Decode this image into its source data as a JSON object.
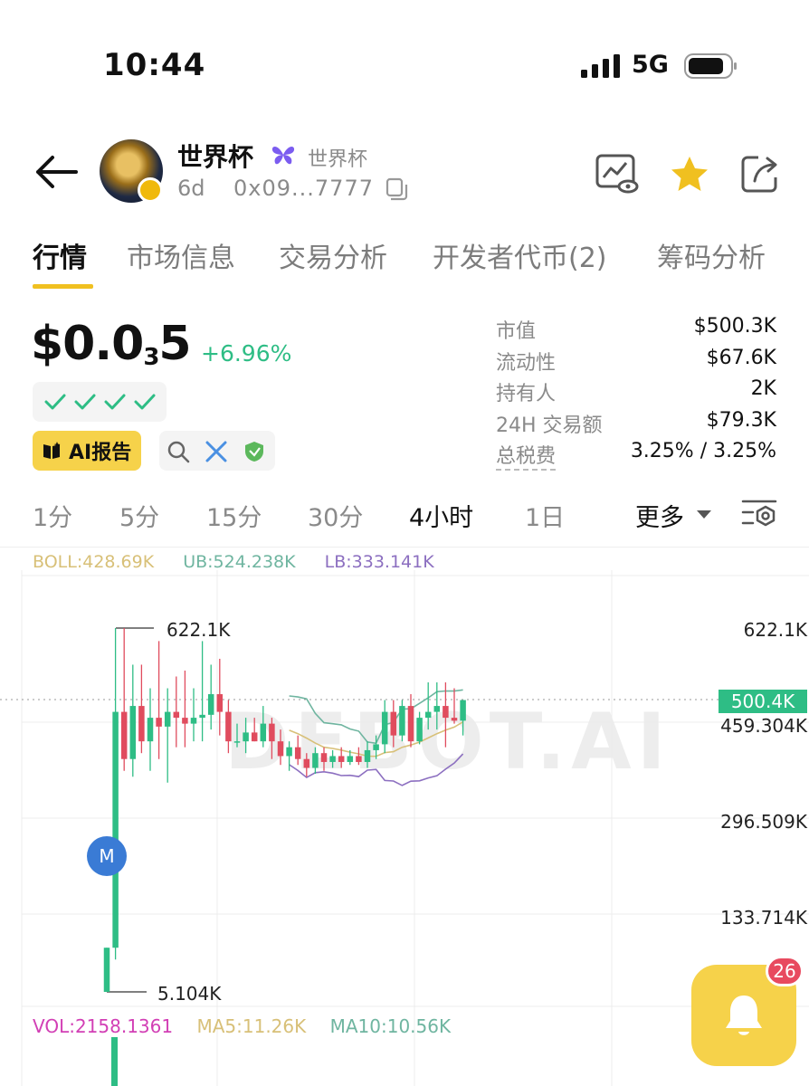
{
  "status_bar": {
    "time": "10:44",
    "network": "5G"
  },
  "header": {
    "token_name": "世界杯",
    "token_subname": "世界杯",
    "age": "6d",
    "address": "0x09...7777"
  },
  "tabs": [
    {
      "label": "行情",
      "active": true
    },
    {
      "label": "市场信息"
    },
    {
      "label": "交易分析"
    },
    {
      "label": "开发者代币(2)"
    },
    {
      "label": "筹码分析"
    }
  ],
  "price": {
    "prefix": "$0.0",
    "zero_count": "3",
    "suffix": "5",
    "change": "+6.96%"
  },
  "badges": {
    "ai_report": "AI报告"
  },
  "stats": [
    {
      "label": "市值",
      "value": "$500.3K"
    },
    {
      "label": "流动性",
      "value": "$67.6K"
    },
    {
      "label": "持有人",
      "value": "2K"
    },
    {
      "label": "24H 交易额",
      "value": "$79.3K"
    },
    {
      "label": "总税费",
      "value": "3.25% / 3.25%"
    }
  ],
  "timeframes": [
    "1分",
    "5分",
    "15分",
    "30分",
    "4小时",
    "1日"
  ],
  "active_timeframe": "4小时",
  "more_label": "更多",
  "colors": {
    "up": "#2ebd85",
    "down": "#e04c5e",
    "accent": "#f0c020"
  },
  "chart_data": {
    "type": "candlestick",
    "indicators": {
      "boll": "BOLL:428.69K",
      "ub": "UB:524.238K",
      "lb": "LB:333.141K"
    },
    "y_axis_ticks": [
      "622.1K",
      "459.304K",
      "296.509K",
      "133.714K"
    ],
    "last_price": "500.4K",
    "high_label": "622.1K",
    "low_label": "5.104K",
    "marker": "M",
    "watermark": "DEBOT.AI",
    "ylim": [
      5.104,
      622.1
    ],
    "candles": [
      {
        "o": 5.1,
        "h": 80,
        "l": 5.1,
        "c": 80
      },
      {
        "o": 80,
        "h": 622.1,
        "l": 60,
        "c": 480
      },
      {
        "o": 480,
        "h": 622.1,
        "l": 380,
        "c": 400
      },
      {
        "o": 400,
        "h": 560,
        "l": 370,
        "c": 490
      },
      {
        "o": 490,
        "h": 560,
        "l": 410,
        "c": 430
      },
      {
        "o": 430,
        "h": 520,
        "l": 380,
        "c": 470
      },
      {
        "o": 470,
        "h": 600,
        "l": 400,
        "c": 455
      },
      {
        "o": 455,
        "h": 520,
        "l": 360,
        "c": 480
      },
      {
        "o": 480,
        "h": 540,
        "l": 420,
        "c": 470
      },
      {
        "o": 470,
        "h": 550,
        "l": 420,
        "c": 460
      },
      {
        "o": 460,
        "h": 520,
        "l": 430,
        "c": 470
      },
      {
        "o": 470,
        "h": 600,
        "l": 430,
        "c": 475
      },
      {
        "o": 475,
        "h": 560,
        "l": 450,
        "c": 510
      },
      {
        "o": 510,
        "h": 570,
        "l": 440,
        "c": 480
      },
      {
        "o": 480,
        "h": 500,
        "l": 410,
        "c": 430
      },
      {
        "o": 430,
        "h": 460,
        "l": 420,
        "c": 430
      },
      {
        "o": 430,
        "h": 470,
        "l": 410,
        "c": 445
      },
      {
        "o": 445,
        "h": 470,
        "l": 430,
        "c": 430
      },
      {
        "o": 430,
        "h": 490,
        "l": 420,
        "c": 460
      },
      {
        "o": 460,
        "h": 470,
        "l": 400,
        "c": 430
      },
      {
        "o": 430,
        "h": 450,
        "l": 390,
        "c": 405
      },
      {
        "o": 405,
        "h": 430,
        "l": 380,
        "c": 420
      },
      {
        "o": 420,
        "h": 440,
        "l": 390,
        "c": 400
      },
      {
        "o": 400,
        "h": 410,
        "l": 370,
        "c": 385
      },
      {
        "o": 385,
        "h": 420,
        "l": 375,
        "c": 410
      },
      {
        "o": 410,
        "h": 420,
        "l": 380,
        "c": 395
      },
      {
        "o": 395,
        "h": 415,
        "l": 385,
        "c": 405
      },
      {
        "o": 405,
        "h": 420,
        "l": 385,
        "c": 395
      },
      {
        "o": 395,
        "h": 415,
        "l": 390,
        "c": 405
      },
      {
        "o": 405,
        "h": 420,
        "l": 390,
        "c": 395
      },
      {
        "o": 395,
        "h": 430,
        "l": 385,
        "c": 415
      },
      {
        "o": 415,
        "h": 440,
        "l": 400,
        "c": 425
      },
      {
        "o": 425,
        "h": 500,
        "l": 410,
        "c": 480
      },
      {
        "o": 480,
        "h": 500,
        "l": 420,
        "c": 440
      },
      {
        "o": 440,
        "h": 500,
        "l": 430,
        "c": 490
      },
      {
        "o": 490,
        "h": 510,
        "l": 420,
        "c": 430
      },
      {
        "o": 430,
        "h": 480,
        "l": 425,
        "c": 470
      },
      {
        "o": 470,
        "h": 530,
        "l": 450,
        "c": 480
      },
      {
        "o": 480,
        "h": 530,
        "l": 450,
        "c": 490
      },
      {
        "o": 490,
        "h": 530,
        "l": 420,
        "c": 470
      },
      {
        "o": 470,
        "h": 520,
        "l": 460,
        "c": 465
      },
      {
        "o": 465,
        "h": 500,
        "l": 440,
        "c": 500
      }
    ],
    "volume_legend": {
      "vol": "VOL:2158.1361",
      "ma5": "MA5:11.26K",
      "ma10": "MA10:10.56K"
    }
  },
  "notification": {
    "badge_count": "26"
  }
}
